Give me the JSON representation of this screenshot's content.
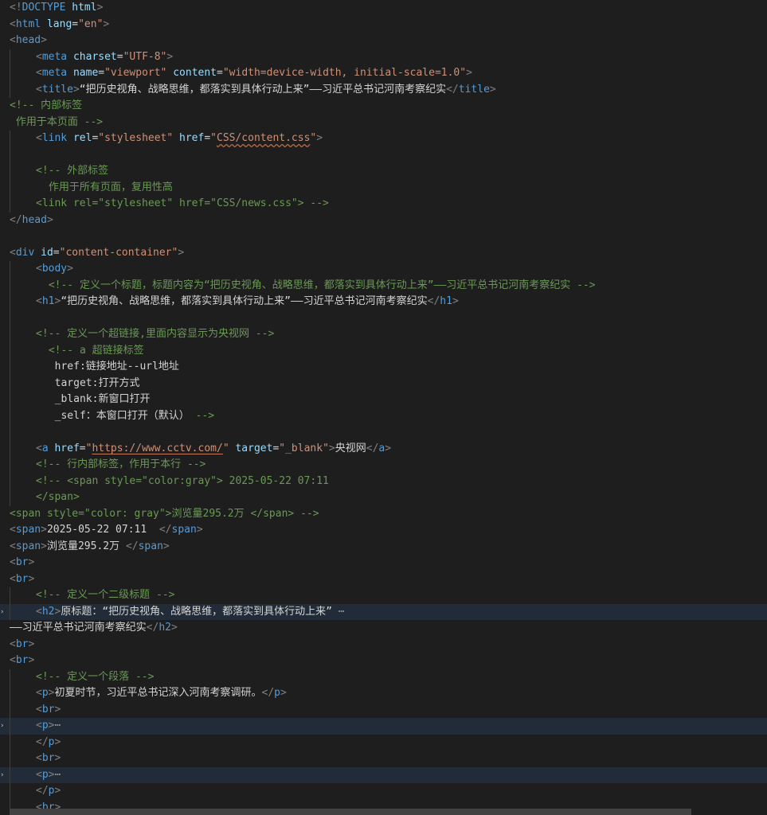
{
  "editor": {
    "lines": [
      {
        "level": 0,
        "fold": false,
        "hl": false,
        "tokens": [
          [
            "br",
            "<!"
          ],
          [
            "tag",
            "DOCTYPE"
          ],
          [
            "txt",
            " "
          ],
          [
            "attr",
            "html"
          ],
          [
            "br",
            ">"
          ]
        ]
      },
      {
        "level": 0,
        "fold": false,
        "hl": false,
        "tokens": [
          [
            "br",
            "<"
          ],
          [
            "tag",
            "html"
          ],
          [
            "txt",
            " "
          ],
          [
            "attr",
            "lang"
          ],
          [
            "txt",
            "="
          ],
          [
            "str",
            "\"en\""
          ],
          [
            "br",
            ">"
          ]
        ]
      },
      {
        "level": 0,
        "fold": false,
        "hl": false,
        "tokens": [
          [
            "br",
            "<"
          ],
          [
            "tag",
            "head"
          ],
          [
            "br",
            ">"
          ]
        ]
      },
      {
        "level": 1,
        "fold": false,
        "hl": false,
        "tokens": [
          [
            "br",
            "<"
          ],
          [
            "tag",
            "meta"
          ],
          [
            "txt",
            " "
          ],
          [
            "attr",
            "charset"
          ],
          [
            "txt",
            "="
          ],
          [
            "str",
            "\"UTF-8\""
          ],
          [
            "br",
            ">"
          ]
        ]
      },
      {
        "level": 1,
        "fold": false,
        "hl": false,
        "tokens": [
          [
            "br",
            "<"
          ],
          [
            "tag",
            "meta"
          ],
          [
            "txt",
            " "
          ],
          [
            "attr",
            "name"
          ],
          [
            "txt",
            "="
          ],
          [
            "str",
            "\"viewport\""
          ],
          [
            "txt",
            " "
          ],
          [
            "attr",
            "content"
          ],
          [
            "txt",
            "="
          ],
          [
            "str",
            "\"width=device-width, initial-scale=1.0\""
          ],
          [
            "br",
            ">"
          ]
        ]
      },
      {
        "level": 1,
        "fold": false,
        "hl": false,
        "tokens": [
          [
            "br",
            "<"
          ],
          [
            "tag",
            "title"
          ],
          [
            "br",
            ">"
          ],
          [
            "txt",
            "“把历史视角、战略思维，都落实到具体行动上来”——习近平总书记河南考察纪实"
          ],
          [
            "br",
            "</"
          ],
          [
            "tag",
            "title"
          ],
          [
            "br",
            ">"
          ]
        ]
      },
      {
        "level": 0,
        "fold": false,
        "hl": false,
        "tokens": [
          [
            "com",
            "<!-- 内部标签"
          ]
        ]
      },
      {
        "level": 0,
        "fold": false,
        "hl": false,
        "tokens": [
          [
            "com",
            " 作用于本页面 -->"
          ]
        ]
      },
      {
        "level": 1,
        "fold": false,
        "hl": false,
        "tokens": [
          [
            "br",
            "<"
          ],
          [
            "tag",
            "link"
          ],
          [
            "txt",
            " "
          ],
          [
            "attr",
            "rel"
          ],
          [
            "txt",
            "="
          ],
          [
            "str",
            "\"stylesheet\""
          ],
          [
            "txt",
            " "
          ],
          [
            "attr",
            "href"
          ],
          [
            "txt",
            "="
          ],
          [
            "str",
            "\""
          ],
          [
            "wave",
            "CSS/content.css"
          ],
          [
            "str",
            "\""
          ],
          [
            "br",
            ">"
          ]
        ]
      },
      {
        "level": 1,
        "fold": false,
        "hl": false,
        "tokens": []
      },
      {
        "level": 1,
        "fold": false,
        "hl": false,
        "tokens": [
          [
            "com",
            "<!-- 外部标签"
          ]
        ]
      },
      {
        "level": 1,
        "sub": 1,
        "fold": false,
        "hl": false,
        "tokens": [
          [
            "com",
            " 作用于所有页面，复用性高"
          ]
        ]
      },
      {
        "level": 1,
        "fold": false,
        "hl": false,
        "tokens": [
          [
            "com",
            "<link rel=\"stylesheet\" href=\"CSS/news.css\"> -->"
          ]
        ]
      },
      {
        "level": 0,
        "fold": false,
        "hl": false,
        "tokens": [
          [
            "br",
            "</"
          ],
          [
            "tag",
            "head"
          ],
          [
            "br",
            ">"
          ]
        ]
      },
      {
        "level": 0,
        "fold": false,
        "hl": false,
        "tokens": []
      },
      {
        "level": 0,
        "fold": false,
        "hl": false,
        "tokens": [
          [
            "br",
            "<"
          ],
          [
            "tag",
            "div"
          ],
          [
            "txt",
            " "
          ],
          [
            "attr",
            "id"
          ],
          [
            "txt",
            "="
          ],
          [
            "str",
            "\"content-container\""
          ],
          [
            "br",
            ">"
          ]
        ]
      },
      {
        "level": 1,
        "fold": false,
        "hl": false,
        "tokens": [
          [
            "br",
            "<"
          ],
          [
            "tag",
            "body"
          ],
          [
            "br",
            ">"
          ]
        ]
      },
      {
        "level": 1,
        "sub": 1,
        "fold": false,
        "hl": false,
        "tokens": [
          [
            "com",
            " <!-- 定义一个标题，标题内容为“把历史视角、战略思维，都落实到具体行动上来”——习近平总书记河南考察纪实 -->"
          ]
        ]
      },
      {
        "level": 1,
        "fold": false,
        "hl": false,
        "tokens": [
          [
            "br",
            "<"
          ],
          [
            "tag",
            "h1"
          ],
          [
            "br",
            ">"
          ],
          [
            "txt",
            "“把历史视角、战略思维，都落实到具体行动上来”——习近平总书记河南考察纪实"
          ],
          [
            "br",
            "</"
          ],
          [
            "tag",
            "h1"
          ],
          [
            "br",
            ">"
          ]
        ]
      },
      {
        "level": 1,
        "fold": false,
        "hl": false,
        "tokens": []
      },
      {
        "level": 1,
        "fold": false,
        "hl": false,
        "tokens": [
          [
            "com",
            "<!-- 定义一个超链接,里面内容显示为央视网 -->"
          ]
        ]
      },
      {
        "level": 1,
        "sub": 1,
        "fold": false,
        "hl": false,
        "tokens": [
          [
            "com",
            " <!-- a 超链接标签"
          ]
        ]
      },
      {
        "level": 1,
        "sub": 1,
        "fold": false,
        "hl": false,
        "tokens": [
          [
            "txt",
            "  href:链接地址--url地址"
          ]
        ]
      },
      {
        "level": 1,
        "sub": 1,
        "fold": false,
        "hl": false,
        "tokens": [
          [
            "txt",
            "  target:打开方式"
          ]
        ]
      },
      {
        "level": 1,
        "sub": 1,
        "fold": false,
        "hl": false,
        "tokens": [
          [
            "txt",
            "  _blank:新窗口打开"
          ]
        ]
      },
      {
        "level": 1,
        "sub": 1,
        "fold": false,
        "hl": false,
        "tokens": [
          [
            "txt",
            "  _self：本窗口打开（默认） "
          ],
          [
            "com",
            "-->"
          ]
        ]
      },
      {
        "level": 1,
        "fold": false,
        "hl": false,
        "tokens": []
      },
      {
        "level": 1,
        "fold": false,
        "hl": false,
        "tokens": [
          [
            "br",
            "<"
          ],
          [
            "tag",
            "a"
          ],
          [
            "txt",
            " "
          ],
          [
            "attr",
            "href"
          ],
          [
            "txt",
            "="
          ],
          [
            "str",
            "\""
          ],
          [
            "link",
            "https://www.cctv.com/"
          ],
          [
            "str",
            "\""
          ],
          [
            "txt",
            " "
          ],
          [
            "attr",
            "target"
          ],
          [
            "txt",
            "="
          ],
          [
            "str",
            "\"_blank\""
          ],
          [
            "br",
            ">"
          ],
          [
            "txt",
            "央视网"
          ],
          [
            "br",
            "</"
          ],
          [
            "tag",
            "a"
          ],
          [
            "br",
            ">"
          ]
        ]
      },
      {
        "level": 1,
        "fold": false,
        "hl": false,
        "tokens": [
          [
            "com",
            "<!-- 行内部标签，作用于本行 -->"
          ]
        ]
      },
      {
        "level": 1,
        "fold": false,
        "hl": false,
        "tokens": [
          [
            "com",
            "<!-- <span style=\"color:gray\"> 2025-05-22 07:11"
          ]
        ]
      },
      {
        "level": 1,
        "fold": false,
        "hl": false,
        "tokens": [
          [
            "com",
            "</span>"
          ]
        ]
      },
      {
        "level": 0,
        "fold": false,
        "hl": false,
        "tokens": [
          [
            "com",
            "<span style=\"color: gray\">浏览量295.2万 </span> -->"
          ]
        ]
      },
      {
        "level": 0,
        "fold": false,
        "hl": false,
        "tokens": [
          [
            "br",
            "<"
          ],
          [
            "tag",
            "span"
          ],
          [
            "br",
            ">"
          ],
          [
            "txt",
            "2025-05-22 07:11  "
          ],
          [
            "br",
            "</"
          ],
          [
            "tag",
            "span"
          ],
          [
            "br",
            ">"
          ]
        ]
      },
      {
        "level": 0,
        "fold": false,
        "hl": false,
        "tokens": [
          [
            "br",
            "<"
          ],
          [
            "tag",
            "span"
          ],
          [
            "br",
            ">"
          ],
          [
            "txt",
            "浏览量295.2万 "
          ],
          [
            "br",
            "</"
          ],
          [
            "tag",
            "span"
          ],
          [
            "br",
            ">"
          ]
        ]
      },
      {
        "level": 0,
        "fold": false,
        "hl": false,
        "tokens": [
          [
            "br",
            "<"
          ],
          [
            "tag",
            "br"
          ],
          [
            "br",
            ">"
          ]
        ]
      },
      {
        "level": 0,
        "fold": false,
        "hl": false,
        "tokens": [
          [
            "br",
            "<"
          ],
          [
            "tag",
            "br"
          ],
          [
            "br",
            ">"
          ]
        ]
      },
      {
        "level": 1,
        "fold": false,
        "hl": false,
        "tokens": [
          [
            "com",
            "<!-- 定义一个二级标题 -->"
          ]
        ]
      },
      {
        "level": 1,
        "fold": true,
        "hl": true,
        "tokens": [
          [
            "br",
            "<"
          ],
          [
            "tag",
            "h2"
          ],
          [
            "br",
            ">"
          ],
          [
            "txt",
            "原标题：“把历史视角、战略思维，都落实到具体行动上来” "
          ],
          [
            "ell",
            "⋯"
          ]
        ]
      },
      {
        "level": 0,
        "fold": false,
        "hl": false,
        "tokens": [
          [
            "txt",
            "——习近平总书记河南考察纪实"
          ],
          [
            "br",
            "</"
          ],
          [
            "tag",
            "h2"
          ],
          [
            "br",
            ">"
          ]
        ]
      },
      {
        "level": 0,
        "fold": false,
        "hl": false,
        "tokens": [
          [
            "br",
            "<"
          ],
          [
            "tag",
            "br"
          ],
          [
            "br",
            ">"
          ]
        ]
      },
      {
        "level": 0,
        "fold": false,
        "hl": false,
        "tokens": [
          [
            "br",
            "<"
          ],
          [
            "tag",
            "br"
          ],
          [
            "br",
            ">"
          ]
        ]
      },
      {
        "level": 1,
        "fold": false,
        "hl": false,
        "tokens": [
          [
            "com",
            "<!-- 定义一个段落 -->"
          ]
        ]
      },
      {
        "level": 1,
        "fold": false,
        "hl": false,
        "tokens": [
          [
            "br",
            "<"
          ],
          [
            "tag",
            "p"
          ],
          [
            "br",
            ">"
          ],
          [
            "txt",
            "初夏时节，习近平总书记深入河南考察调研。"
          ],
          [
            "br",
            "</"
          ],
          [
            "tag",
            "p"
          ],
          [
            "br",
            ">"
          ]
        ]
      },
      {
        "level": 1,
        "fold": false,
        "hl": false,
        "tokens": [
          [
            "br",
            "<"
          ],
          [
            "tag",
            "br"
          ],
          [
            "br",
            ">"
          ]
        ]
      },
      {
        "level": 1,
        "fold": true,
        "hl": true,
        "tokens": [
          [
            "br",
            "<"
          ],
          [
            "tag",
            "p"
          ],
          [
            "br",
            ">"
          ],
          [
            "ell",
            "⋯"
          ]
        ]
      },
      {
        "level": 1,
        "fold": false,
        "hl": false,
        "tokens": [
          [
            "br",
            "</"
          ],
          [
            "tag",
            "p"
          ],
          [
            "br",
            ">"
          ]
        ]
      },
      {
        "level": 1,
        "fold": false,
        "hl": false,
        "tokens": [
          [
            "br",
            "<"
          ],
          [
            "tag",
            "br"
          ],
          [
            "br",
            ">"
          ]
        ]
      },
      {
        "level": 1,
        "fold": true,
        "hl": true,
        "tokens": [
          [
            "br",
            "<"
          ],
          [
            "tag",
            "p"
          ],
          [
            "br",
            ">"
          ],
          [
            "ell",
            "⋯"
          ]
        ]
      },
      {
        "level": 1,
        "fold": false,
        "hl": false,
        "tokens": [
          [
            "br",
            "</"
          ],
          [
            "tag",
            "p"
          ],
          [
            "br",
            ">"
          ]
        ]
      },
      {
        "level": 1,
        "fold": false,
        "hl": false,
        "tokens": [
          [
            "br",
            "<"
          ],
          [
            "tag",
            "br"
          ],
          [
            "br",
            ">"
          ]
        ]
      }
    ],
    "fold_icon": "chevron-right-icon",
    "colors": {
      "background": "#1e1e1e",
      "tag": "#569cd6",
      "bracket": "#808080",
      "attribute": "#9cdcfe",
      "string": "#ce9178",
      "text": "#d4d4d4",
      "comment": "#6a9955",
      "line_highlight": "#222c38"
    }
  }
}
